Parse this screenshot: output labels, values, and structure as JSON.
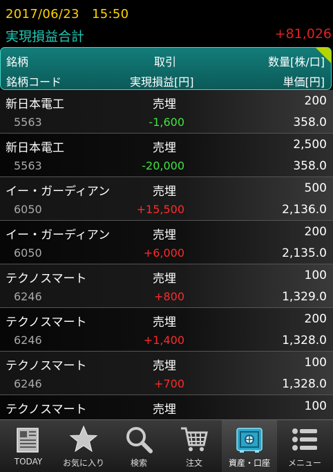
{
  "status": {
    "datetime": "2017/06/23　15:50"
  },
  "summary": {
    "label": "実現損益合計",
    "value": "+81,026"
  },
  "header": {
    "col1": "銘柄",
    "col2": "取引",
    "col3": "数量[株/口]",
    "col4": "銘柄コード",
    "col5": "実現損益[円]",
    "col6": "単価[円]"
  },
  "rows": [
    {
      "name": "新日本電工",
      "trade": "売埋",
      "qty": "200",
      "code": "5563",
      "pl": "-1,600",
      "price": "358.0"
    },
    {
      "name": "新日本電工",
      "trade": "売埋",
      "qty": "2,500",
      "code": "5563",
      "pl": "-20,000",
      "price": "358.0"
    },
    {
      "name": "イー・ガーディアン",
      "trade": "売埋",
      "qty": "500",
      "code": "6050",
      "pl": "+15,500",
      "price": "2,136.0"
    },
    {
      "name": "イー・ガーディアン",
      "trade": "売埋",
      "qty": "200",
      "code": "6050",
      "pl": "+6,000",
      "price": "2,135.0"
    },
    {
      "name": "テクノスマート",
      "trade": "売埋",
      "qty": "100",
      "code": "6246",
      "pl": "+800",
      "price": "1,329.0"
    },
    {
      "name": "テクノスマート",
      "trade": "売埋",
      "qty": "200",
      "code": "6246",
      "pl": "+1,400",
      "price": "1,328.0"
    },
    {
      "name": "テクノスマート",
      "trade": "売埋",
      "qty": "100",
      "code": "6246",
      "pl": "+700",
      "price": "1,328.0"
    },
    {
      "name": "テクノスマート",
      "trade": "売埋",
      "qty": "100",
      "code": "",
      "pl": "",
      "price": ""
    }
  ],
  "nav": [
    {
      "label": "TODAY",
      "icon": "newspaper-icon"
    },
    {
      "label": "お気に入り",
      "icon": "star-icon"
    },
    {
      "label": "検索",
      "icon": "search-icon"
    },
    {
      "label": "注文",
      "icon": "cart-icon"
    },
    {
      "label": "資産・口座",
      "icon": "safe-icon",
      "active": true
    },
    {
      "label": "メニュー",
      "icon": "menu-list-icon"
    }
  ],
  "colors": {
    "positive": "#ff2a2a",
    "negative": "#3ee33e",
    "accent": "#21c9b5",
    "date": "#ffd400"
  }
}
